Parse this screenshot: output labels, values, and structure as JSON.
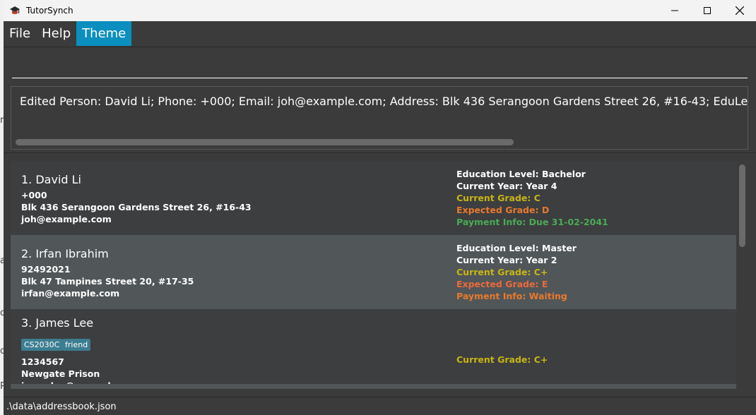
{
  "window": {
    "title": "TutorSynch"
  },
  "menu": {
    "items": [
      "File",
      "Help",
      "Theme"
    ],
    "active": "Theme"
  },
  "command": {
    "value": ""
  },
  "result": {
    "text": "Edited Person: David Li; Phone: +000; Email: joh@example.com; Address: Blk 436 Serangoon Gardens Street 26, #16-43; EduLevel: Bachelor; C"
  },
  "persons": [
    {
      "name": "1. David Li",
      "tags": [],
      "phone": "+000",
      "address": "Blk 436 Serangoon Gardens Street 26, #16-43",
      "email": "joh@example.com",
      "education": "Education Level: Bachelor",
      "year": "Current Year: Year 4",
      "current_grade": "Current Grade: C",
      "expected_grade": "Expected Grade: D",
      "payment": "Payment Info: Due 31-02-2041"
    },
    {
      "name": "2. Irfan Ibrahim",
      "tags": [],
      "phone": "92492021",
      "address": "Blk 47 Tampines Street 20, #17-35",
      "email": "irfan@example.com",
      "education": "Education Level: Master",
      "year": "Current Year: Year 2",
      "current_grade": "Current Grade: C+",
      "expected_grade": "Expected Grade: E",
      "payment": "Payment Info: Waiting"
    },
    {
      "name": "3. James Lee",
      "tags": [
        "CS2030C",
        "friend"
      ],
      "phone": "1234567",
      "address": "Newgate Prison",
      "email": "jameslee@example.com",
      "current_grade": "Current Grade: C+"
    }
  ],
  "status": {
    "path": ".\\data\\addressbook.json"
  },
  "background_peek": [
    "r",
    "a",
    "o",
    "o",
    "P"
  ],
  "colors": {
    "accent": "#0a8fbf",
    "background": "#3b3b3b",
    "card_alt": "#515658",
    "current_grade": "#c8b515",
    "expected_grade": "#e87a2c",
    "payment_due": "#4aab56",
    "tag": "#3d7d91"
  }
}
